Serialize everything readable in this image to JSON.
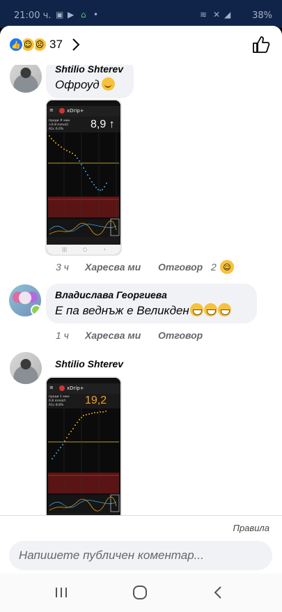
{
  "status_bar": {
    "time": "21:00 ч.",
    "battery": "38%"
  },
  "reactions": {
    "count": "37",
    "emojis": [
      "like-icon",
      "haha-icon",
      "sad-icon"
    ]
  },
  "comments": [
    {
      "author": "Shtilio Shterev",
      "text": "Офроуд",
      "emoji": "smile",
      "time": "3 ч",
      "like": "Харесва ми",
      "reply": "Отговор",
      "reaction_count": "2",
      "image": {
        "app": "xDrip+",
        "value": "8,9 ↑",
        "info": [
          "преди # мин",
          "+0.8 mmol/l",
          "A1c 6.0%"
        ]
      }
    },
    {
      "author": "Владислава Георгиева",
      "text": "Е па веднъж е Великден",
      "emoji": "grin×3",
      "time": "1 ч",
      "like": "Харесва ми",
      "reply": "Отговор"
    },
    {
      "author": "Shtilio Shterev",
      "image": {
        "app": "xDrip+",
        "value": "19,2 →",
        "info": [
          "преди 1 мин",
          "0.8 mmol/l",
          "A1c 8.8%"
        ]
      }
    }
  ],
  "footer": {
    "rules": "Правила",
    "placeholder": "Напишете публичен коментар..."
  },
  "colors": {
    "facebook_blue": "#1877f2",
    "bubble": "#f0f2f5",
    "meta_grey": "#65676b"
  }
}
